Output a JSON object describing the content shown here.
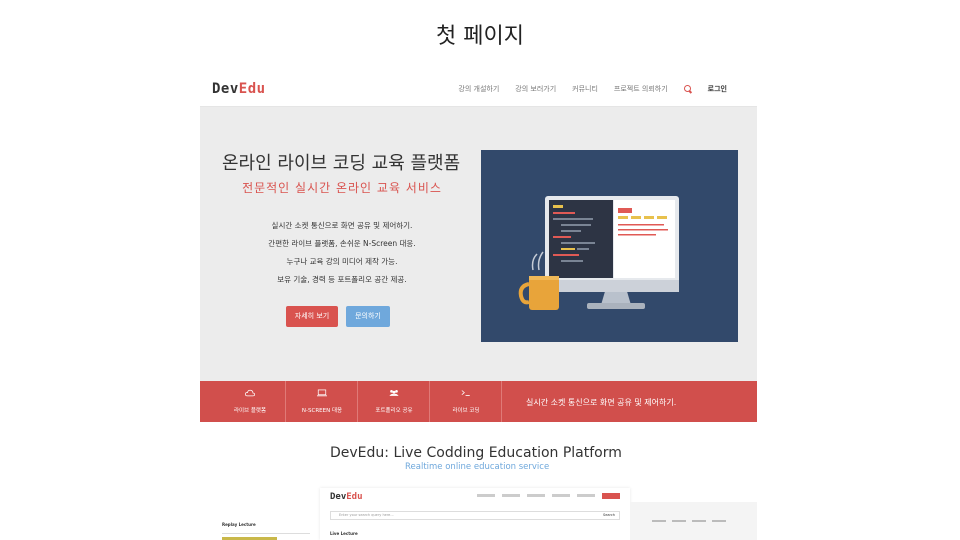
{
  "slide_title": "첫 페이지",
  "site": {
    "logo": {
      "text_prefix": "Dev",
      "text_suffix": "Edu"
    },
    "nav": {
      "items": [
        "강의 개설하기",
        "강의 보러가기",
        "커뮤니티",
        "프로젝트 의뢰하기"
      ],
      "search_icon": "search-icon",
      "login": "로그인"
    },
    "hero": {
      "title": "온라인 라이브 코딩 교육 플랫폼",
      "subtitle": "전문적인 실시간 온라인 교육 서비스",
      "features": [
        "실시간 소켓 통신으로 화면 공유 및 제어하기.",
        "간편한 라이브 플랫폼, 손쉬운 N-Screen 대응.",
        "누구나 교육 강의 미디어 제작 가능.",
        "보유 기술, 경력 등 포트폴리오 공간 제공."
      ],
      "buttons": {
        "detail": "자세히 보기",
        "contact": "문의하기"
      }
    },
    "feature_bar": {
      "items": [
        {
          "icon": "cloud-icon",
          "label": "라이브 플랫폼"
        },
        {
          "icon": "monitor-icon",
          "label": "N-SCREEN 대응"
        },
        {
          "icon": "users-icon",
          "label": "포트폴리오 공유"
        },
        {
          "icon": "terminal-icon",
          "label": "라이브 코딩"
        }
      ],
      "slogan": "실시간 소켓 통신으로 화면 공유 및 제어하기."
    },
    "section": {
      "title": "DevEdu: Live Codding Education Platform",
      "subtitle": "Realtime online education service"
    },
    "preview": {
      "logo_prefix": "Dev",
      "logo_suffix": "Edu",
      "search_placeholder": "Enter your search query here...",
      "search_button": "Search",
      "live_lecture": "Live Lecture",
      "replay_lecture": "Replay Lecture"
    }
  },
  "colors": {
    "accent": "#d9534f",
    "secondary": "#6fa8dc",
    "illustration_bg": "#32496b"
  }
}
